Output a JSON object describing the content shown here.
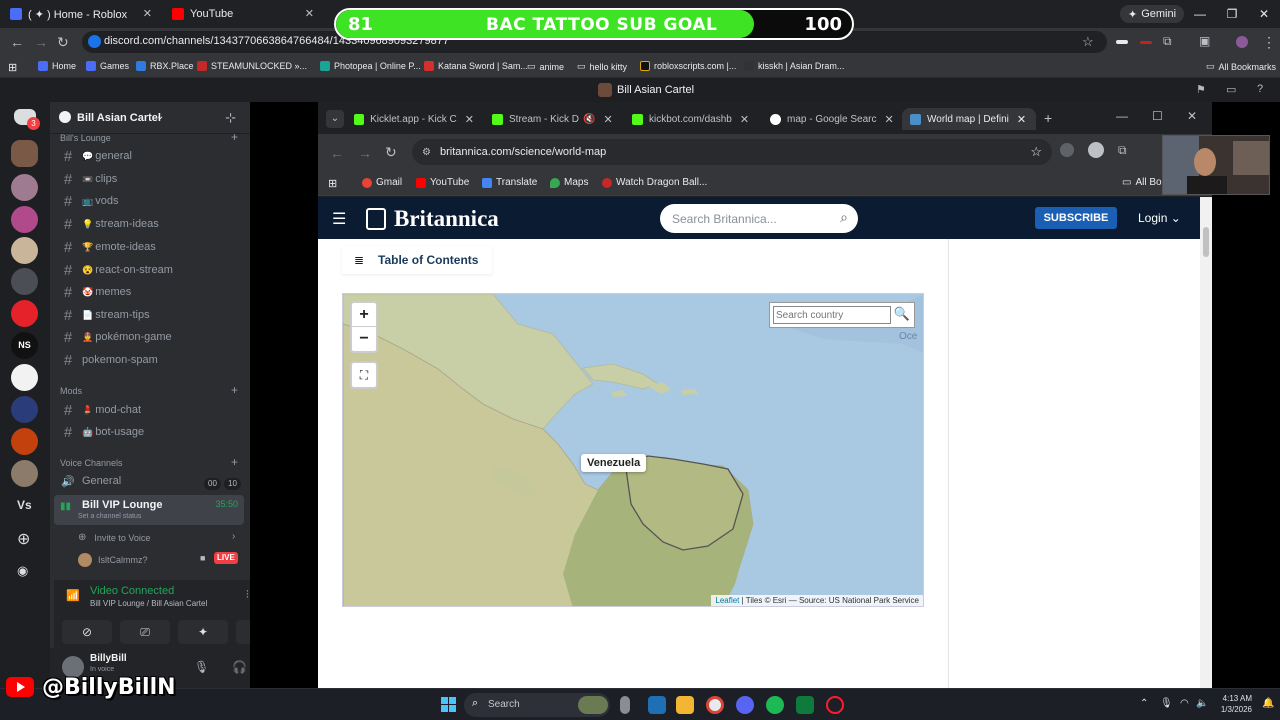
{
  "outer_browser": {
    "tabs": [
      {
        "title": "( ✦ ) Home - Roblox"
      },
      {
        "title": "YouTube"
      }
    ],
    "gemini_label": "Gemini",
    "url": "discord.com/channels/1343770663864766484/1433409689093279877",
    "bookmarks": [
      "Home",
      "Games",
      "RBX.Place",
      "STEAMUNLOCKED »...",
      "Photopea | Online P...",
      "Katana Sword | Sam...",
      "anime",
      "hello kitty",
      "robloxscripts.com |...",
      "kisskh | Asian Dram...",
      "All Bookmarks"
    ]
  },
  "sub_goal": {
    "current": "81",
    "title": "BAC TATTOO SUB GOAL",
    "target": "100",
    "progress": 0.81
  },
  "discord": {
    "window_title": "Bill Asian Cartel",
    "server_name": "Bill Asian Cartel",
    "notification_count": "3",
    "rail_label": "Vs",
    "categories": {
      "lounge": "Bill's Lounge",
      "mods": "Mods",
      "voice": "Voice Channels"
    },
    "channels": [
      {
        "name": "general",
        "emoji": "💬"
      },
      {
        "name": "clips",
        "emoji": "📼"
      },
      {
        "name": "vods",
        "emoji": "📺"
      },
      {
        "name": "stream-ideas",
        "emoji": "💡"
      },
      {
        "name": "emote-ideas",
        "emoji": "🏆"
      },
      {
        "name": "react-on-stream",
        "emoji": "😵"
      },
      {
        "name": "memes",
        "emoji": "🤡"
      },
      {
        "name": "stream-tips",
        "emoji": "📄"
      },
      {
        "name": "pokémon-game",
        "emoji": "👲"
      },
      {
        "name": "pokemon-spam",
        "emoji": ""
      }
    ],
    "mod_channels": [
      {
        "name": "mod-chat",
        "emoji": "💄"
      },
      {
        "name": "bot-usage",
        "emoji": "🤖"
      }
    ],
    "voice_general": {
      "name": "General",
      "count_a": "00",
      "count_b": "10"
    },
    "voice_active": {
      "name": "Bill VIP Lounge",
      "timer": "35:50",
      "status": "Set a channel status"
    },
    "invite_label": "Invite to Voice",
    "member": {
      "name": "IsltCalmmz?",
      "badge": "LIVE"
    },
    "rtc": {
      "title": "Video Connected",
      "subtitle": "Bill VIP Lounge / Bill Asian Cartel"
    },
    "user": {
      "name": "BillyBill",
      "status": "In voice"
    }
  },
  "inner_browser": {
    "tabs": [
      {
        "title": "Kicklet.app - Kick C"
      },
      {
        "title": "Stream - Kick D"
      },
      {
        "title": "kickbot.com/dashb"
      },
      {
        "title": "map - Google Searc"
      },
      {
        "title": "World map | Defini"
      }
    ],
    "url": "britannica.com/science/world-map",
    "bookmarks": [
      "Gmail",
      "YouTube",
      "Translate",
      "Maps",
      "Watch Dragon Ball...",
      "All Bo"
    ]
  },
  "britannica": {
    "logo": "Britannica",
    "search_placeholder": "Search Britannica...",
    "subscribe": "SUBSCRIBE",
    "login": "Login",
    "toc": "Table of Contents"
  },
  "map": {
    "zoom_in": "+",
    "zoom_out": "−",
    "search_placeholder": "Search country",
    "country_label": "Venezuela",
    "corner_text": "Oce",
    "attribution_link": "Leaflet",
    "attribution_text": " | Tiles © Esri — Source: US National Park Service"
  },
  "watermark": {
    "handle": "@BillyBillN"
  },
  "taskbar": {
    "search": "Search",
    "time": "4:13 AM",
    "date": "1/3/2026"
  }
}
